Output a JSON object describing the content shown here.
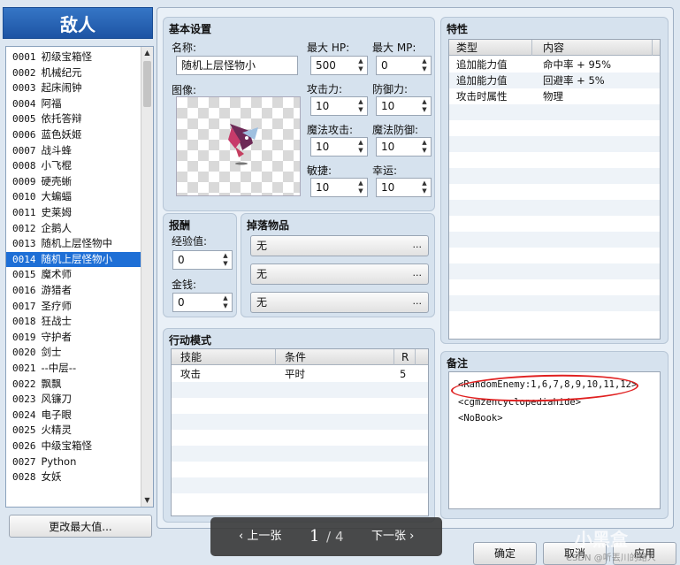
{
  "enemy_list": {
    "title": "敌人",
    "selected_index": 13,
    "items": [
      {
        "id": "0001",
        "name": "初级宝箱怪"
      },
      {
        "id": "0002",
        "name": "机械纪元"
      },
      {
        "id": "0003",
        "name": "起床闹钟"
      },
      {
        "id": "0004",
        "name": "阿福"
      },
      {
        "id": "0005",
        "name": "依托答辩"
      },
      {
        "id": "0006",
        "name": "蓝色妖姬"
      },
      {
        "id": "0007",
        "name": "战斗蜂"
      },
      {
        "id": "0008",
        "name": "小飞棍"
      },
      {
        "id": "0009",
        "name": "硬壳蜥"
      },
      {
        "id": "0010",
        "name": "大蝙蝠"
      },
      {
        "id": "0011",
        "name": "史莱姆"
      },
      {
        "id": "0012",
        "name": "企鹅人"
      },
      {
        "id": "0013",
        "name": "随机上层怪物中"
      },
      {
        "id": "0014",
        "name": "随机上层怪物小"
      },
      {
        "id": "0015",
        "name": "魔术师"
      },
      {
        "id": "0016",
        "name": "游猎者"
      },
      {
        "id": "0017",
        "name": "圣疗师"
      },
      {
        "id": "0018",
        "name": "狂战士"
      },
      {
        "id": "0019",
        "name": "守护者"
      },
      {
        "id": "0020",
        "name": "剑士"
      },
      {
        "id": "0021",
        "name": "--中层--"
      },
      {
        "id": "0022",
        "name": "飘飘"
      },
      {
        "id": "0023",
        "name": "风镰刀"
      },
      {
        "id": "0024",
        "name": "电子眼"
      },
      {
        "id": "0025",
        "name": "火精灵"
      },
      {
        "id": "0026",
        "name": "中级宝箱怪"
      },
      {
        "id": "0027",
        "name": "Python"
      },
      {
        "id": "0028",
        "name": "女妖"
      }
    ],
    "change_max_label": "更改最大值..."
  },
  "basic": {
    "title": "基本设置",
    "name_label": "名称:",
    "name_value": "随机上层怪物小",
    "image_label": "图像:",
    "max_hp_label": "最大 HP:",
    "max_hp": "500",
    "max_mp_label": "最大 MP:",
    "max_mp": "0",
    "atk_label": "攻击力:",
    "atk": "10",
    "def_label": "防御力:",
    "def": "10",
    "mat_label": "魔法攻击:",
    "mat": "10",
    "mdf_label": "魔法防御:",
    "mdf": "10",
    "agi_label": "敏捷:",
    "agi": "10",
    "luk_label": "幸运:",
    "luk": "10"
  },
  "rewards": {
    "title": "报酬",
    "exp_label": "经验值:",
    "exp": "0",
    "gold_label": "金钱:",
    "gold": "0"
  },
  "drops": {
    "title": "掉落物品",
    "items": [
      "无",
      "无",
      "无"
    ],
    "dots": "..."
  },
  "actions": {
    "title": "行动模式",
    "headers": [
      "技能",
      "条件",
      "R"
    ],
    "rows": [
      {
        "skill": "攻击",
        "condition": "平时",
        "rating": "5"
      }
    ]
  },
  "traits": {
    "title": "特性",
    "headers": [
      "类型",
      "内容"
    ],
    "rows": [
      {
        "type": "追加能力值",
        "content": "命中率 + 95%"
      },
      {
        "type": "追加能力值",
        "content": "回避率 + 5%"
      },
      {
        "type": "攻击时属性",
        "content": "物理"
      }
    ]
  },
  "notes": {
    "title": "备注",
    "lines": [
      "<RandomEnemy:1,6,7,8,9,10,11,12>",
      "<cgmzencyclopediahide>",
      "<NoBook>"
    ]
  },
  "pager": {
    "prev": "‹ 上一张",
    "current": "1",
    "separator": "/",
    "total": "4",
    "next": "下一张 ›"
  },
  "buttons": {
    "ok": "确定",
    "cancel": "取消",
    "apply": "应用"
  },
  "watermark": "小黑盒",
  "watermark_sub": "CSDN @听丟川的路人"
}
